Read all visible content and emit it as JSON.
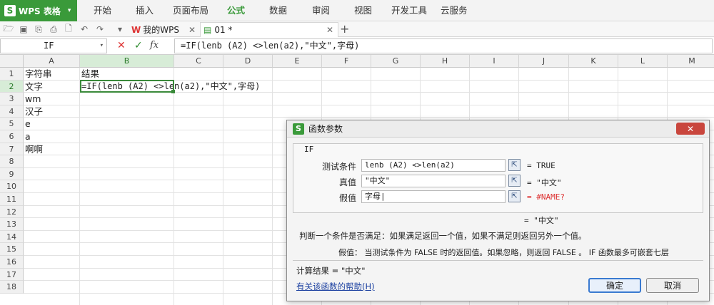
{
  "app": {
    "name": "WPS 表格",
    "logo": "S"
  },
  "menu": [
    "开始",
    "插入",
    "页面布局",
    "公式",
    "数据",
    "审阅",
    "视图",
    "开发工具",
    "云服务"
  ],
  "menu_active_index": 3,
  "tabs": [
    {
      "label": "我的WPS"
    },
    {
      "label": "01 *"
    }
  ],
  "namebox": "IF",
  "formula": "=IF(lenb (A2) <>len(a2),\"中文\",字母)",
  "columns": [
    "A",
    "B",
    "C",
    "D",
    "E",
    "F",
    "G",
    "H",
    "I",
    "J",
    "K",
    "L",
    "M"
  ],
  "selected_column": "B",
  "rows": [
    "1",
    "2",
    "3",
    "4",
    "5",
    "6",
    "7",
    "8",
    "9",
    "10",
    "11",
    "12",
    "13",
    "14",
    "15",
    "16",
    "17",
    "18"
  ],
  "selected_row": "2",
  "cells": {
    "A1": "字符串",
    "B1": "结果",
    "A2": "文字",
    "B2": "=IF(lenb (A2) <>len(a2),\"中文\",字母)",
    "A3": "wm",
    "A4": "汉子",
    "A5": "e",
    "A6": "a",
    "A7": "啊啊"
  },
  "dialog": {
    "title": "函数参数",
    "function_name": "IF",
    "args": [
      {
        "label": "测试条件",
        "value": "lenb (A2) <>len(a2)",
        "result": "= TRUE"
      },
      {
        "label": "真值",
        "value": "\"中文\"",
        "result": "= \"中文\""
      },
      {
        "label": "假值",
        "value": "字母|",
        "result": "= #NAME?"
      }
    ],
    "formula_result": "= \"中文\"",
    "description": "判断一个条件是否满足：如果满足返回一个值，如果不满足则返回另外一个值。",
    "param_label": "假值：",
    "param_description": "当测试条件为 FALSE 时的返回值。如果忽略，则返回 FALSE 。 IF 函数最多可嵌套七层",
    "calc_result": "计算结果 = \"中文\"",
    "help_link": "有关该函数的帮助(H)",
    "ok_label": "确定",
    "cancel_label": "取消"
  }
}
